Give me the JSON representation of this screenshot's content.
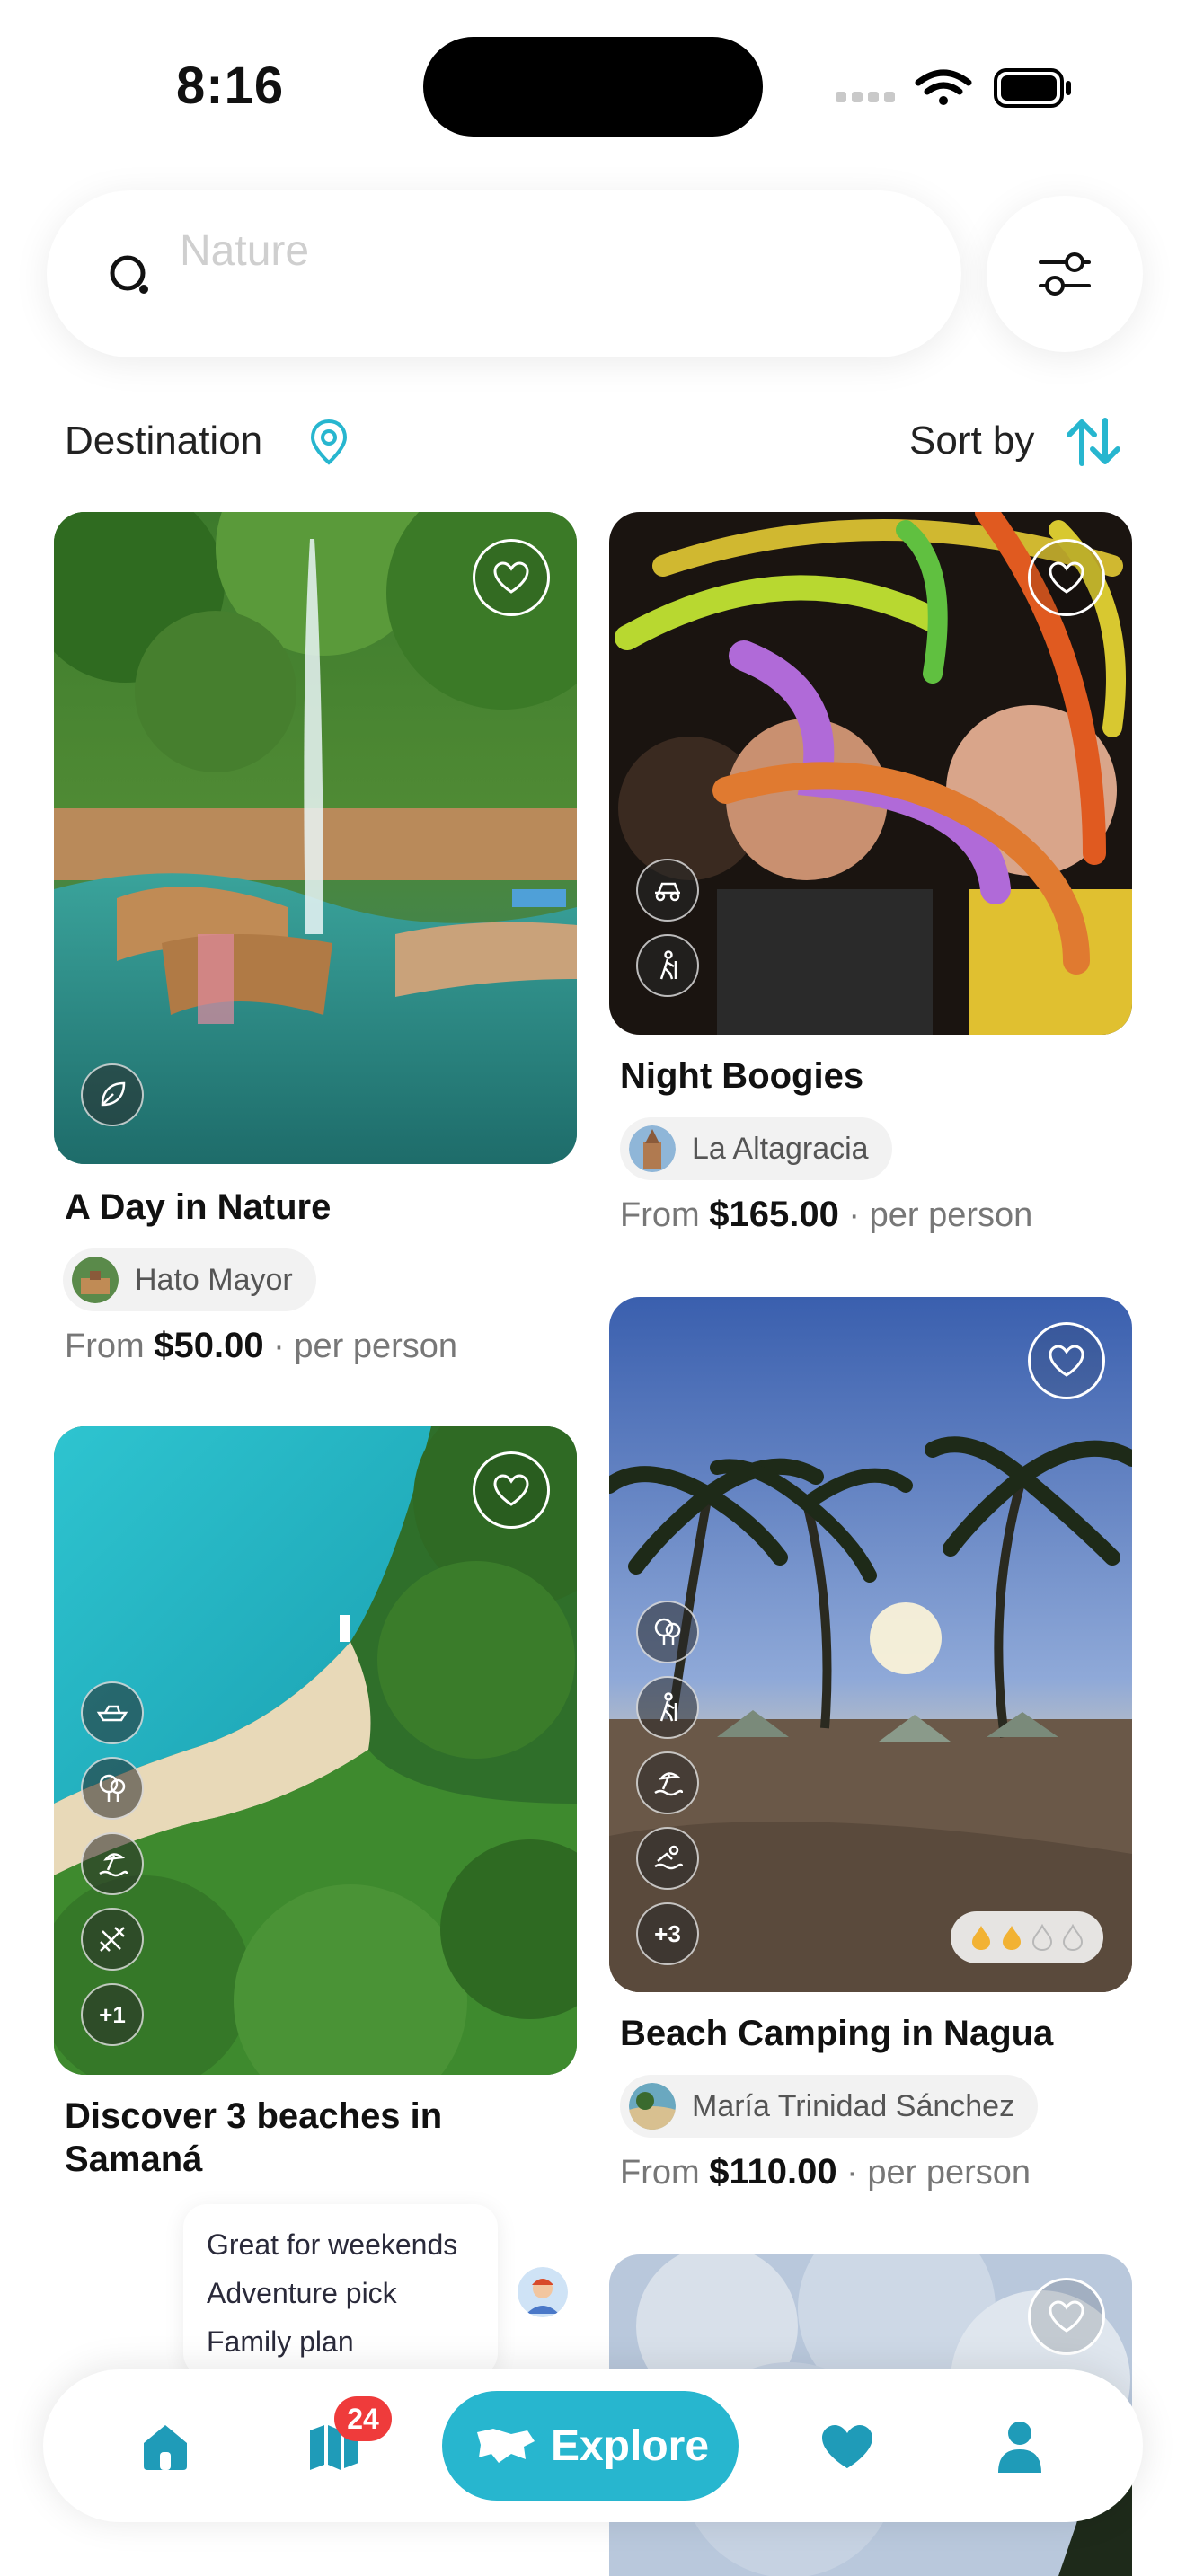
{
  "status_bar": {
    "time": "8:16"
  },
  "search": {
    "placeholder": "Nature",
    "value": ""
  },
  "filters": {
    "destination_label": "Destination",
    "sort_label": "Sort by"
  },
  "price_prefix": "From",
  "price_suffix": "· per person",
  "cards": [
    {
      "title": "A Day in Nature",
      "location": "Hato Mayor",
      "price": "$50.00",
      "activities": [
        "leaf-icon"
      ]
    },
    {
      "title": "Night Boogies",
      "location": "La Altagracia",
      "price": "$165.00",
      "activities": [
        "buggy-icon",
        "hiking-icon"
      ]
    },
    {
      "title": "Discover 3 beaches in Samaná",
      "location": "",
      "price": "",
      "activities": [
        "boat-icon",
        "tree-icon",
        "beach-icon",
        "kayak-icon"
      ],
      "more": "+1"
    },
    {
      "title": "Beach Camping in Nagua",
      "location": "María Trinidad Sánchez",
      "price": "$110.00",
      "activities": [
        "tree-icon",
        "hiking-icon",
        "beach-icon",
        "swimming-icon"
      ],
      "more": "+3",
      "intensity_level": 2,
      "intensity_max": 4
    }
  ],
  "tooltip": {
    "items": [
      "Great for weekends",
      "Adventure pick",
      "Family plan"
    ]
  },
  "bottom_nav": {
    "home": "home-icon",
    "map": "map-icon",
    "map_badge": "24",
    "explore_label": "Explore",
    "favorites": "heart-icon",
    "profile": "user-icon"
  },
  "colors": {
    "accent": "#27b6cf",
    "badge": "#ef3b3b"
  }
}
